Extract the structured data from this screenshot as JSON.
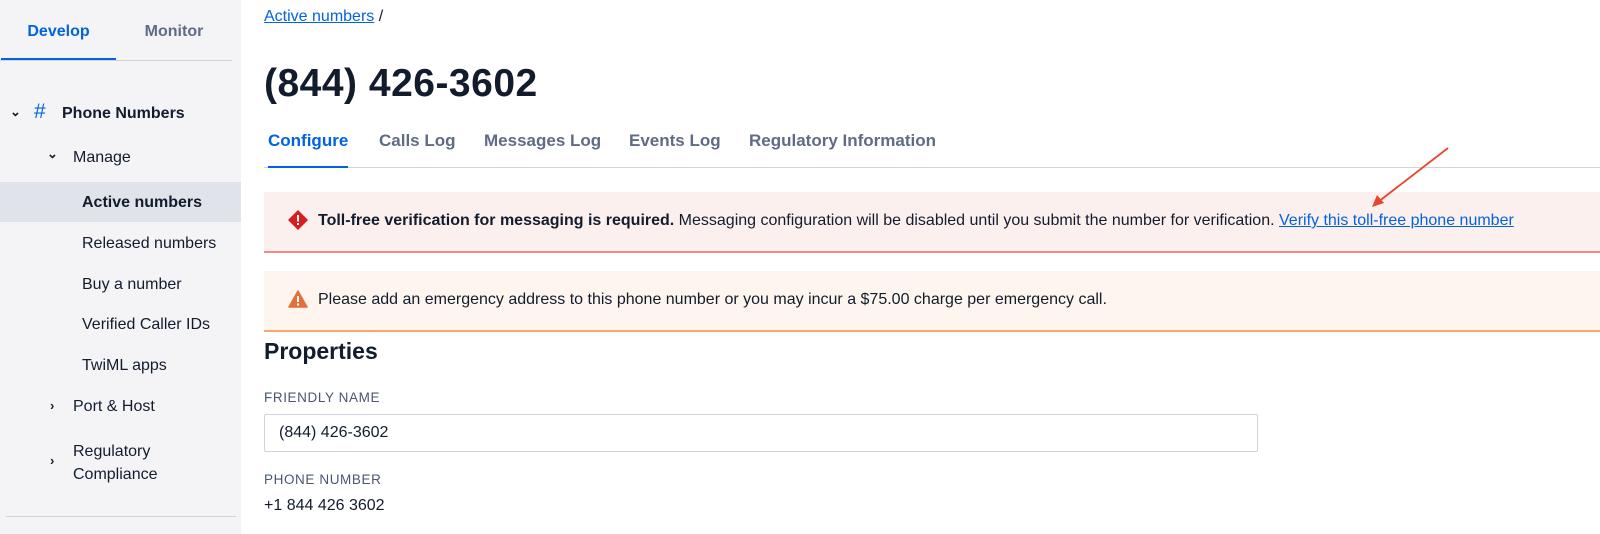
{
  "sidebar": {
    "tabs": [
      {
        "label": "Develop",
        "active": true
      },
      {
        "label": "Monitor",
        "active": false
      }
    ],
    "section": "Phone Numbers",
    "manage": "Manage",
    "items": [
      {
        "label": "Active numbers",
        "active": true
      },
      {
        "label": "Released numbers"
      },
      {
        "label": "Buy a number"
      },
      {
        "label": "Verified Caller IDs"
      },
      {
        "label": "TwiML apps"
      }
    ],
    "port_host": "Port & Host",
    "regulatory_line1": "Regulatory",
    "regulatory_line2": "Compliance"
  },
  "breadcrumb": {
    "link": "Active numbers",
    "sep": "/"
  },
  "page_title": "(844) 426-3602",
  "tabs": [
    "Configure",
    "Calls Log",
    "Messages Log",
    "Events Log",
    "Regulatory Information"
  ],
  "alerts": {
    "error_bold": "Toll-free verification for messaging is required.",
    "error_text": " Messaging configuration will be disabled until you submit the number for verification. ",
    "error_link": "Verify this toll-free phone number",
    "warn_text": "Please add an emergency address to this phone number or you may incur a $75.00 charge per emergency call."
  },
  "properties": {
    "heading": "Properties",
    "friendly_label": "FRIENDLY NAME",
    "friendly_value": "(844) 426-3602",
    "phone_label": "PHONE NUMBER",
    "phone_value": "+1 844 426 3602"
  },
  "colors": {
    "accent": "#0263e0",
    "error": "#d61f1f",
    "warning": "#e0703c",
    "annotation_arrow": "#e8452c"
  },
  "icons": {
    "expand": "chevron-down-icon",
    "collapsed": "chevron-right-icon",
    "section": "hash-icon",
    "error": "error-diamond-icon",
    "warning": "warning-triangle-icon"
  }
}
